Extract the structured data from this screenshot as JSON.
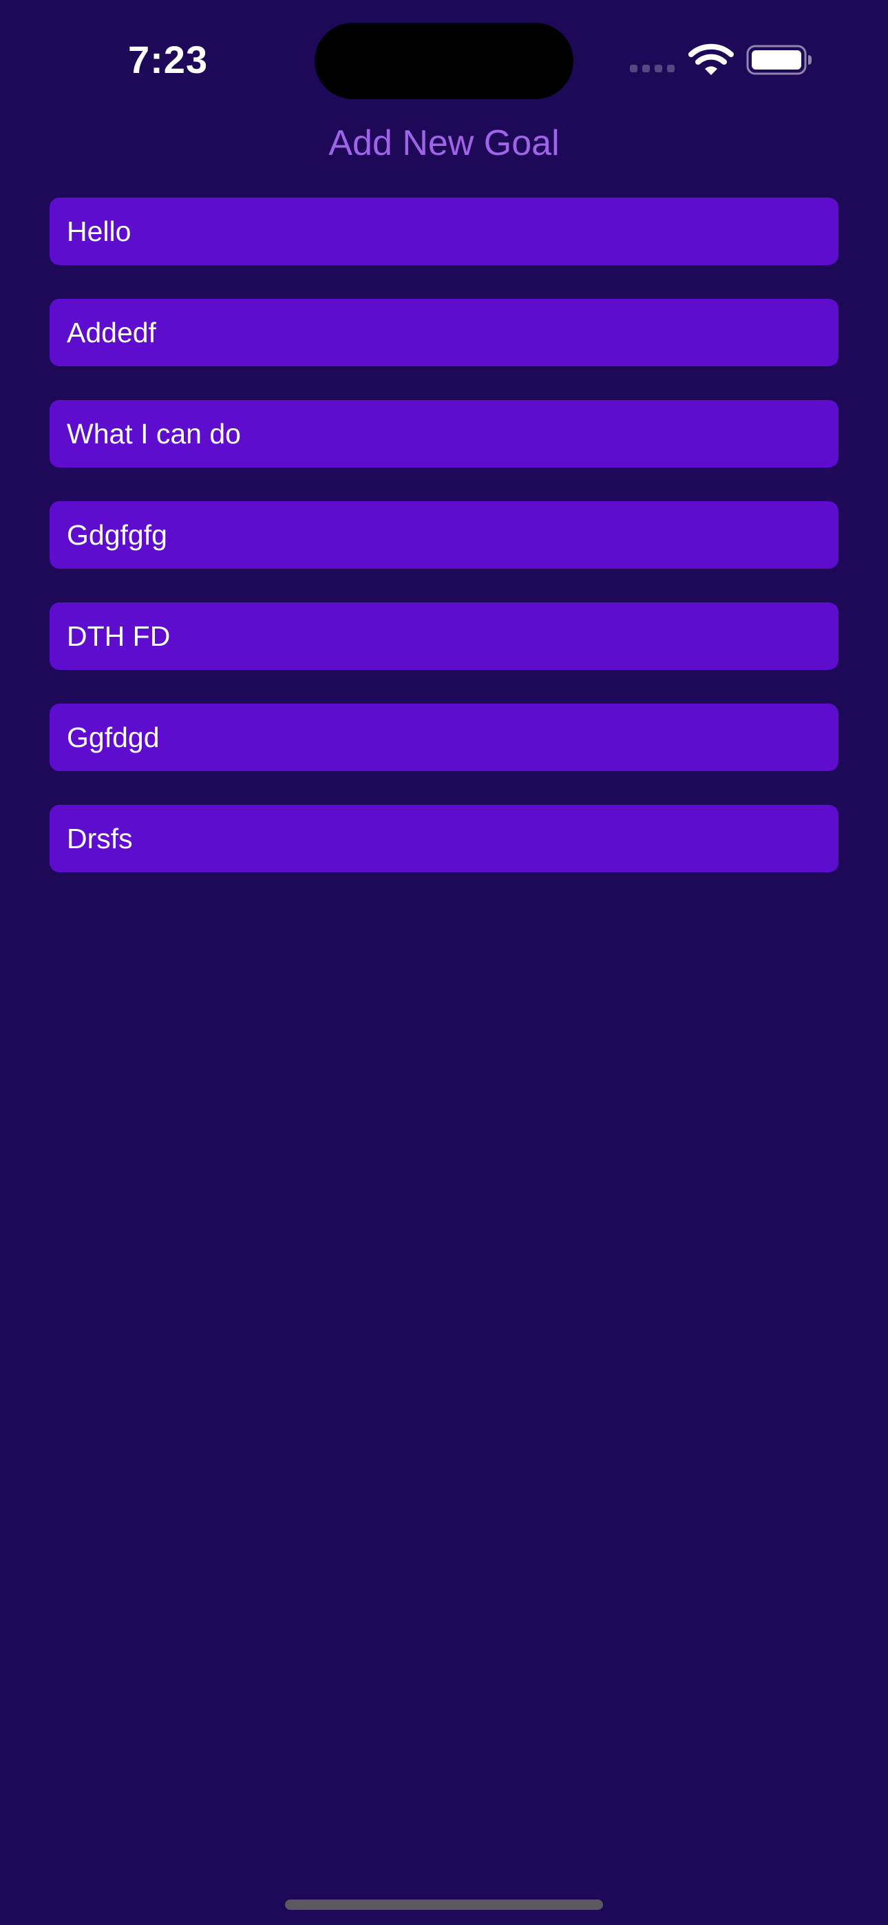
{
  "status_bar": {
    "time": "7:23",
    "signal_icon": "cellular-signal-icon",
    "wifi_icon": "wifi-icon",
    "battery_icon": "battery-icon"
  },
  "header": {
    "title": "Add New Goal"
  },
  "goals": [
    {
      "text": "Hello"
    },
    {
      "text": "Addedf"
    },
    {
      "text": "What I can do"
    },
    {
      "text": "Gdgfgfg"
    },
    {
      "text": "DTH FD"
    },
    {
      "text": "Ggfdgd"
    },
    {
      "text": "Drsfs"
    }
  ],
  "colors": {
    "background": "#1e0858",
    "goal_item": "#5e0ccd",
    "title": "#a064e8",
    "text": "#ffffff"
  }
}
